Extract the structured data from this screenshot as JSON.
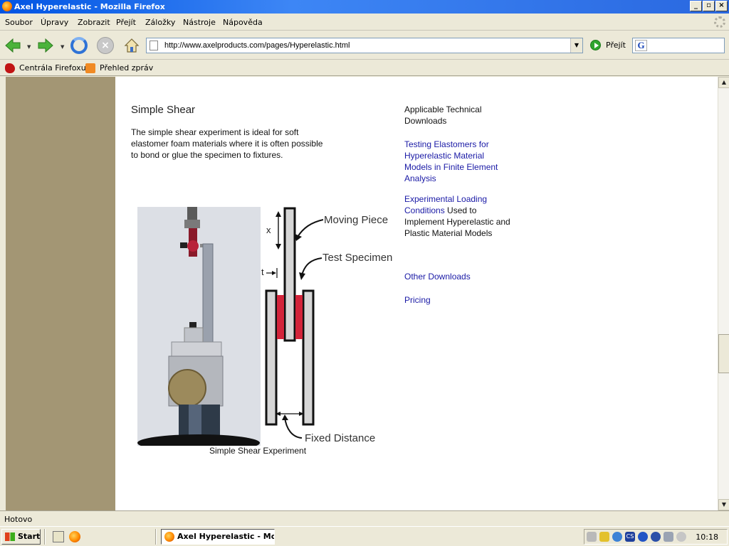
{
  "window": {
    "title": "Axel Hyperelastic - Mozilla Firefox"
  },
  "menu": [
    "Soubor",
    "Úpravy",
    "Zobrazit",
    "Přejít",
    "Záložky",
    "Nástroje",
    "Nápověda"
  ],
  "nav": {
    "url": "http://www.axelproducts.com/pages/Hyperelastic.html",
    "go_label": "Přejít"
  },
  "bookmarks": [
    "Centrála Firefoxu",
    "Přehled zpráv"
  ],
  "content": {
    "heading": "Simple Shear",
    "intro": "The simple shear experiment is ideal for soft elastomer foam materials where it is often possible to bond or glue the specimen to fixtures.",
    "figure": {
      "labels": {
        "moving_piece": "Moving Piece",
        "test_specimen": "Test Specimen",
        "fixed_distance": "Fixed Distance",
        "x": "x",
        "t": "t"
      },
      "caption": "Simple Shear Experiment"
    },
    "sidebar": {
      "heading": "Applicable Technical Downloads",
      "link1": "Testing Elastomers for Hyperelastic Material Models in Finite Element Analysis",
      "link2": "Experimental Loading Conditions",
      "link2_suffix": " Used to Implement Hyperelastic and Plastic Material Models",
      "link3": "Other Downloads",
      "link4": "Pricing"
    }
  },
  "status": "Hotovo",
  "taskbar": {
    "start": "Start",
    "task": "Axel Hyperelastic - Mo...",
    "clock": "10:18"
  },
  "colors": {
    "tan_column": "#a39674",
    "link": "#1a1aa6",
    "specimen": "#d3243a"
  }
}
